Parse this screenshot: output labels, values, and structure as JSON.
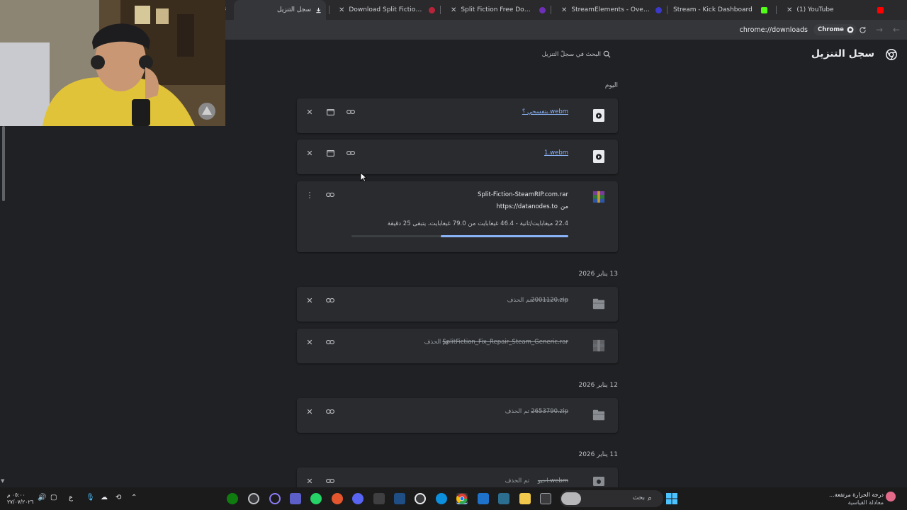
{
  "browser": {
    "tabs": [
      {
        "label": "سجل التنزيل",
        "active": true
      },
      {
        "label": "Download Split Fiction SteamRi",
        "active": false
      },
      {
        "label": "Split Fiction Free Download (v5",
        "active": false
      },
      {
        "label": "StreamElements - Overlays",
        "active": false
      },
      {
        "label": "Stream - Kick Dashboard",
        "active": false
      },
      {
        "label": "(1) YouTube",
        "active": false
      }
    ],
    "partial_tab_glyph": "‹",
    "url": "chrome://downloads",
    "chip_label": "Chrome"
  },
  "page": {
    "title": "سجل التنزيل",
    "search_placeholder": "البحث في سجلّ التنزيل"
  },
  "groups": [
    {
      "date": "اليوم",
      "items": [
        {
          "name": "بتفسحي ؟.webm",
          "status": "",
          "icon": "video-file-icon"
        },
        {
          "name": "1.webm",
          "status": "",
          "icon": "video-file-icon"
        },
        {
          "name": "Split-Fiction-SteamRIP.com.rar",
          "source_prefix": "من",
          "source": "https://datanodes.to",
          "progress_text": "22.4 ميغابايت/ثانية - 46.4 غيغابايت من 79.0 غيغابايت، يتبقى 25 دقيقة",
          "progress": 0.5873,
          "icon": "winrar-icon"
        }
      ]
    },
    {
      "date": "13 يناير 2026",
      "items": [
        {
          "name": "2001120.zip",
          "status": "تم الحذف",
          "icon": "zip-file-icon"
        },
        {
          "name": "SplitFiction_Fix_Repair_Steam_Generic.rar",
          "status": "تم الحذف",
          "icon": "winrar-icon"
        }
      ]
    },
    {
      "date": "12 يناير 2026",
      "items": [
        {
          "name": "2653790.zip",
          "status": "تم الحذف",
          "icon": "zip-file-icon"
        }
      ]
    },
    {
      "date": "11 يناير 2026",
      "items": [
        {
          "name": "احبو.webm",
          "status": "تم الحذف",
          "icon": "video-file-icon"
        }
      ]
    }
  ],
  "taskbar": {
    "search_label": "بحث",
    "clock_time": "٠٥:٠٠ م",
    "clock_date": "٢٧/٠٧/٢٠٢٦",
    "weather_line1": "درجة الحرارة مرتفعة...",
    "weather_line2": "معادلة القياسية",
    "lang": "ع"
  },
  "colors": {
    "accent": "#8ab4f8",
    "background": "#202124",
    "card": "#2a2b2e"
  }
}
